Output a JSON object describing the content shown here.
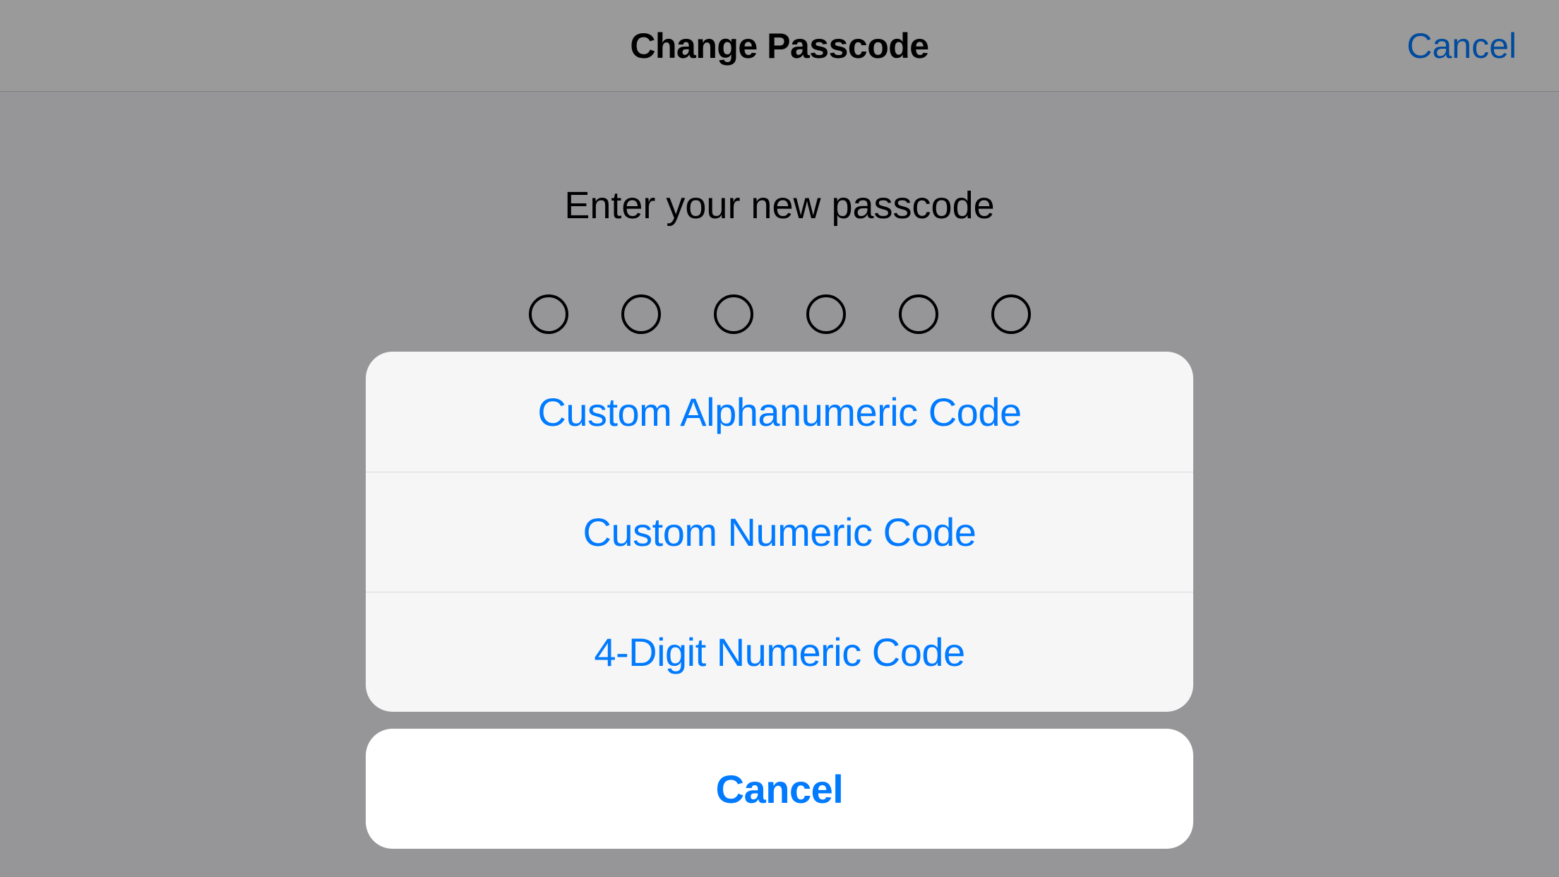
{
  "header": {
    "title": "Change Passcode",
    "cancel_label": "Cancel"
  },
  "prompt": "Enter your new passcode",
  "passcode_length": 6,
  "action_sheet": {
    "options": [
      "Custom Alphanumeric Code",
      "Custom Numeric Code",
      "4-Digit Numeric Code"
    ],
    "cancel_label": "Cancel"
  },
  "colors": {
    "tint": "#007aff",
    "background": "#f2f2f7"
  }
}
